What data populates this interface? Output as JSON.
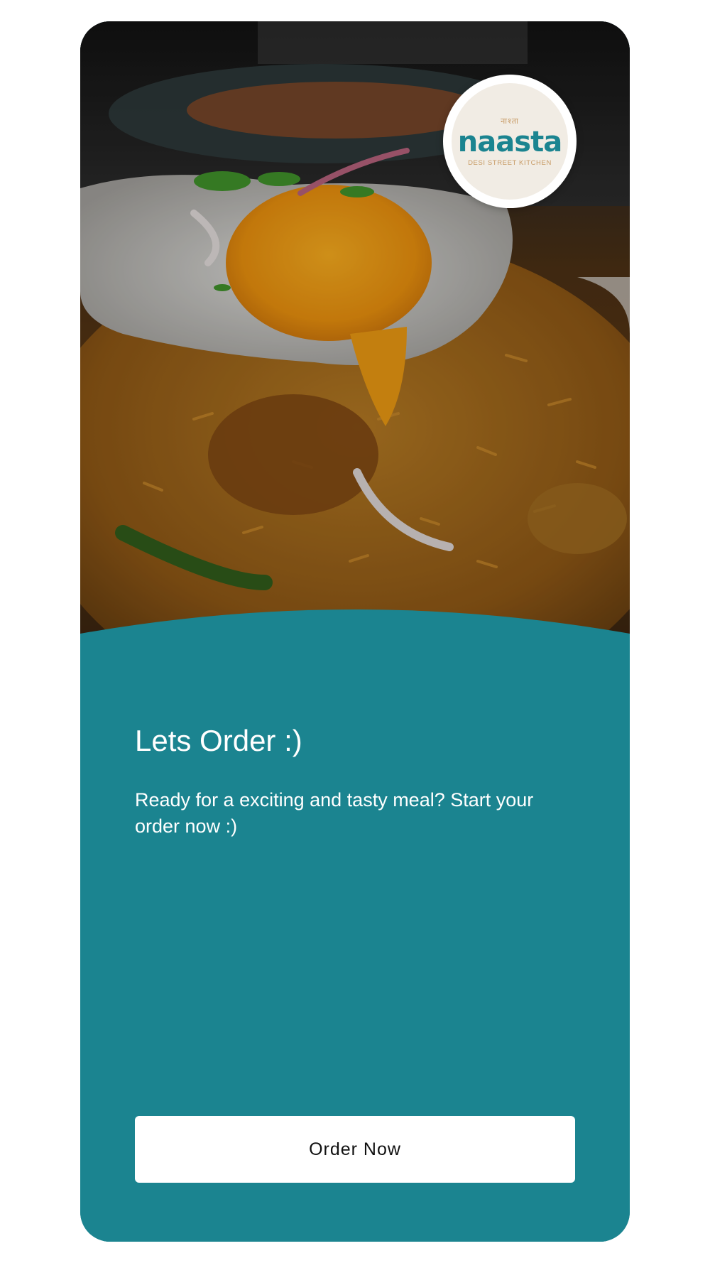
{
  "brand": {
    "name": "naasta",
    "tagline": "DESI STREET KITCHEN",
    "mark": "नाश्ता",
    "color_primary": "#1b8490",
    "color_accent": "#c79a64"
  },
  "hero": {
    "image": "food-photo",
    "subject": "fried-egg-on-biryani"
  },
  "content": {
    "title": "Lets Order :)",
    "subtitle": "Ready for a exciting and tasty meal? Start your order now :)"
  },
  "actions": {
    "order_label": "Order Now"
  },
  "colors": {
    "panel": "#1b8490",
    "button_bg": "#ffffff",
    "button_text": "#111111",
    "text_on_panel": "#ffffff"
  }
}
